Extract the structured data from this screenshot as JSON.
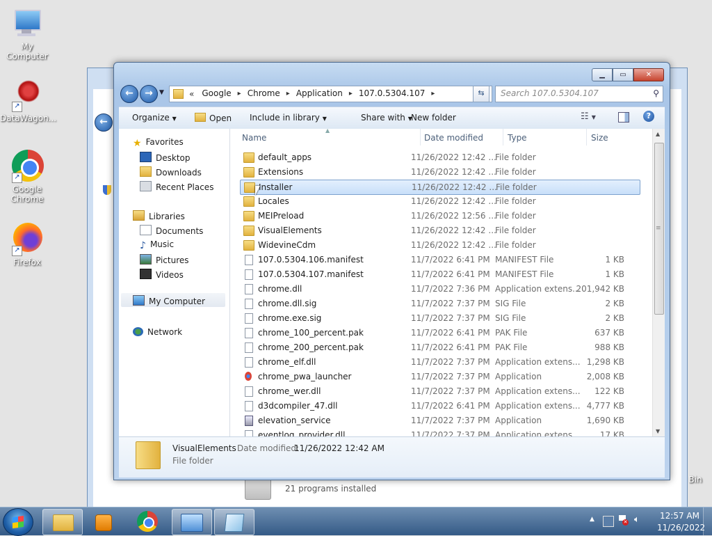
{
  "desktop": {
    "icons": [
      {
        "label": "My Computer"
      },
      {
        "label": "DataWagon..."
      },
      {
        "label": "Google Chrome"
      },
      {
        "label": "Firefox"
      },
      {
        "label": "Recycle Bin"
      }
    ]
  },
  "back_window": {
    "status_text": "21 programs installed"
  },
  "explorer": {
    "address": {
      "overflow": "«",
      "crumbs": [
        "Google",
        "Chrome",
        "Application",
        "107.0.5304.107"
      ]
    },
    "search": {
      "placeholder": "Search 107.0.5304.107"
    },
    "toolbar": {
      "organize": "Organize",
      "open": "Open",
      "include_in_library": "Include in library",
      "share_with": "Share with",
      "new_folder": "New folder"
    },
    "nav": {
      "favorites": "Favorites",
      "desktop": "Desktop",
      "downloads": "Downloads",
      "recent_places": "Recent Places",
      "libraries": "Libraries",
      "documents": "Documents",
      "music": "Music",
      "pictures": "Pictures",
      "videos": "Videos",
      "my_computer": "My Computer",
      "network": "Network"
    },
    "columns": {
      "name": "Name",
      "date": "Date modified",
      "type": "Type",
      "size": "Size"
    },
    "files": [
      {
        "name": "default_apps",
        "date": "11/26/2022 12:42 ...",
        "type": "File folder",
        "size": "",
        "kind": "folder"
      },
      {
        "name": "Extensions",
        "date": "11/26/2022 12:42 ...",
        "type": "File folder",
        "size": "",
        "kind": "folder"
      },
      {
        "name": "Installer",
        "date": "11/26/2022 12:42 ...",
        "type": "File folder",
        "size": "",
        "kind": "folder"
      },
      {
        "name": "Locales",
        "date": "11/26/2022 12:42 ...",
        "type": "File folder",
        "size": "",
        "kind": "folder"
      },
      {
        "name": "MEIPreload",
        "date": "11/26/2022 12:56 ...",
        "type": "File folder",
        "size": "",
        "kind": "folder"
      },
      {
        "name": "VisualElements",
        "date": "11/26/2022 12:42 ...",
        "type": "File folder",
        "size": "",
        "kind": "folder"
      },
      {
        "name": "WidevineCdm",
        "date": "11/26/2022 12:42 ...",
        "type": "File folder",
        "size": "",
        "kind": "folder"
      },
      {
        "name": "107.0.5304.106.manifest",
        "date": "11/7/2022 6:41 PM",
        "type": "MANIFEST File",
        "size": "1 KB",
        "kind": "doc"
      },
      {
        "name": "107.0.5304.107.manifest",
        "date": "11/7/2022 6:41 PM",
        "type": "MANIFEST File",
        "size": "1 KB",
        "kind": "doc"
      },
      {
        "name": "chrome.dll",
        "date": "11/7/2022 7:36 PM",
        "type": "Application extens...",
        "size": "201,942 KB",
        "kind": "dll"
      },
      {
        "name": "chrome.dll.sig",
        "date": "11/7/2022 7:37 PM",
        "type": "SIG File",
        "size": "2 KB",
        "kind": "doc"
      },
      {
        "name": "chrome.exe.sig",
        "date": "11/7/2022 7:37 PM",
        "type": "SIG File",
        "size": "2 KB",
        "kind": "doc"
      },
      {
        "name": "chrome_100_percent.pak",
        "date": "11/7/2022 6:41 PM",
        "type": "PAK File",
        "size": "637 KB",
        "kind": "doc"
      },
      {
        "name": "chrome_200_percent.pak",
        "date": "11/7/2022 6:41 PM",
        "type": "PAK File",
        "size": "988 KB",
        "kind": "doc"
      },
      {
        "name": "chrome_elf.dll",
        "date": "11/7/2022 7:37 PM",
        "type": "Application extens...",
        "size": "1,298 KB",
        "kind": "dll"
      },
      {
        "name": "chrome_pwa_launcher",
        "date": "11/7/2022 7:37 PM",
        "type": "Application",
        "size": "2,008 KB",
        "kind": "app"
      },
      {
        "name": "chrome_wer.dll",
        "date": "11/7/2022 7:37 PM",
        "type": "Application extens...",
        "size": "122 KB",
        "kind": "dll"
      },
      {
        "name": "d3dcompiler_47.dll",
        "date": "11/7/2022 6:41 PM",
        "type": "Application extens...",
        "size": "4,777 KB",
        "kind": "dll"
      },
      {
        "name": "elevation_service",
        "date": "11/7/2022 7:37 PM",
        "type": "Application",
        "size": "1,690 KB",
        "kind": "exe"
      },
      {
        "name": "eventlog_provider.dll",
        "date": "11/7/2022 7:37 PM",
        "type": "Application extens...",
        "size": "17 KB",
        "kind": "dll"
      }
    ],
    "selected_index": 2,
    "details": {
      "name": "VisualElements",
      "date_label": "Date modified:",
      "date_value": "11/26/2022 12:42 AM",
      "type": "File folder"
    }
  },
  "taskbar": {
    "time": "12:57 AM",
    "date": "11/26/2022"
  }
}
